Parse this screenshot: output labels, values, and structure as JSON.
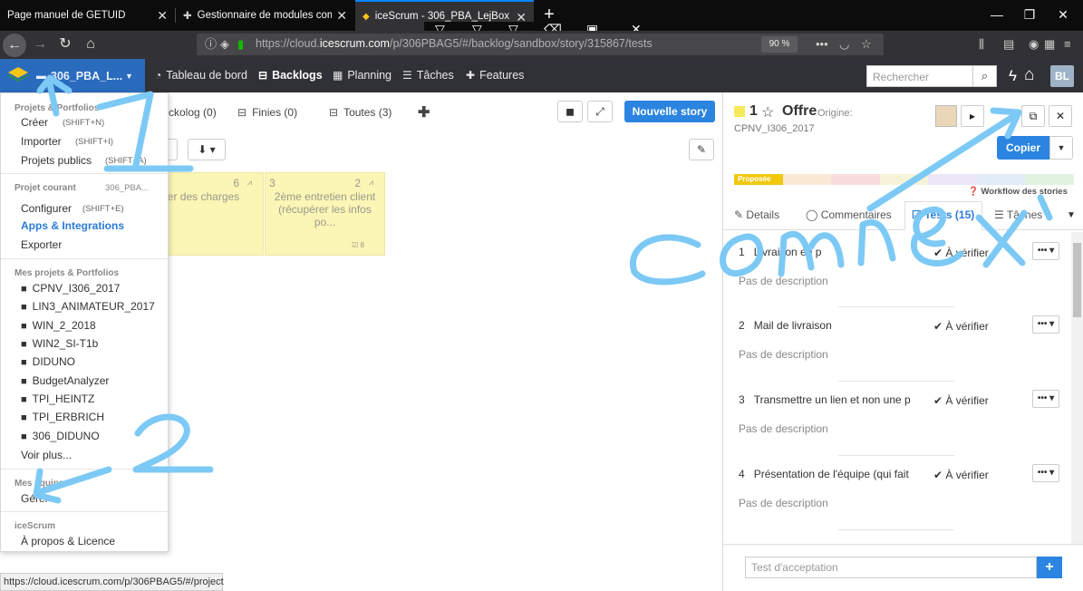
{
  "browser": {
    "tabs": [
      {
        "title": "Page manuel de GETUID",
        "close": "✕"
      },
      {
        "title": "Gestionnaire de modules comp",
        "close": "✕"
      },
      {
        "title": "iceScrum - 306_PBA_LejBox",
        "close": "✕"
      }
    ],
    "new_tab": "+",
    "url": {
      "prefix": "https://cloud.",
      "domain": "icescrum.com",
      "path": "/p/306PBAG5/#/backlog/sandbox/story/315867/tests"
    },
    "zoom": "90 %",
    "status_url": "https://cloud.icescrum.com/p/306PBAG5/#/project"
  },
  "app": {
    "project_label": "306_PBA_L...",
    "nav": [
      {
        "label": "Tableau de bord",
        "icon": "dashboard-icon"
      },
      {
        "label": "Backlogs",
        "icon": "inbox-icon"
      },
      {
        "label": "Planning",
        "icon": "calendar-icon"
      },
      {
        "label": "Tâches",
        "icon": "tasks-icon"
      },
      {
        "label": "Features",
        "icon": "puzzle-icon"
      }
    ],
    "search_placeholder": "Rechercher",
    "user_initials": "BL"
  },
  "backlogs": {
    "tabs": [
      {
        "label": "ckolog (0)"
      },
      {
        "label": "Finies (0)"
      },
      {
        "label": "Toutes (3)"
      }
    ],
    "new_story": "Nouvelle story",
    "stories": [
      {
        "number": "",
        "points": "6",
        "title": "er des charges",
        "tasks": ""
      },
      {
        "number": "3",
        "points": "2",
        "title": "2ème entretien client (récupérer les infos po...",
        "tasks": "8"
      }
    ]
  },
  "dropdown": {
    "section_projects": "Projets & Portfolios",
    "create": "Créer",
    "create_shortcut": "(SHIFT+N)",
    "import": "Importer",
    "import_shortcut": "(SHIFT+I)",
    "public": "Projets publics",
    "public_shortcut": "(SHIFT+A)",
    "section_current": "Projet courant",
    "current_name": "306_PBA...",
    "configure": "Configurer",
    "configure_shortcut": "(SHIFT+E)",
    "apps": "Apps & Integrations",
    "export": "Exporter",
    "section_mine": "Mes projets & Portfolios",
    "projects": [
      "CPNV_I306_2017",
      "LIN3_ANIMATEUR_2017",
      "WIN_2_2018",
      "WIN2_SI-T1b",
      "DIDUNO",
      "BudgetAnalyzer",
      "TPI_HEINTZ",
      "TPI_ERBRICH",
      "306_DIDUNO"
    ],
    "see_more": "Voir plus...",
    "section_teams": "Mes équipes",
    "manage": "Gérer",
    "section_icescrum": "iceScrum",
    "about": "À propos & Licence"
  },
  "story": {
    "id": "1",
    "name": "Offre",
    "origin_label": "Origine:",
    "origin_value": "CPNV_I306_2017",
    "copy_label": "Copier",
    "state": "Proposée",
    "workflow_link": "Workflow des stories",
    "tabs": [
      "Details",
      "Commentaires",
      "Tests (15)",
      "Tâches"
    ],
    "tests": [
      {
        "num": "1",
        "title": "Livraison en p",
        "state": "À vérifier",
        "desc": "Pas de description"
      },
      {
        "num": "2",
        "title": "Mail de livraison",
        "state": "À vérifier",
        "desc": "Pas de description"
      },
      {
        "num": "3",
        "title": "Transmettre un lien et non une p",
        "state": "À vérifier",
        "desc": "Pas de description"
      },
      {
        "num": "4",
        "title": "Présentation de l'équipe (qui fait",
        "state": "À vérifier",
        "desc": "Pas de description"
      }
    ],
    "acceptance_placeholder": "Test d'acceptation",
    "add_test": "+"
  },
  "annotations": {
    "handwritten_text": "connex",
    "marks": [
      "1",
      "2"
    ],
    "color": "#7cc9f5"
  },
  "colors": {
    "accent": "#2b85e0",
    "header": "#303136",
    "project_bar": "#2a6bbd",
    "postit": "#fbf5b6",
    "state_proposed": "#f2c80f"
  }
}
